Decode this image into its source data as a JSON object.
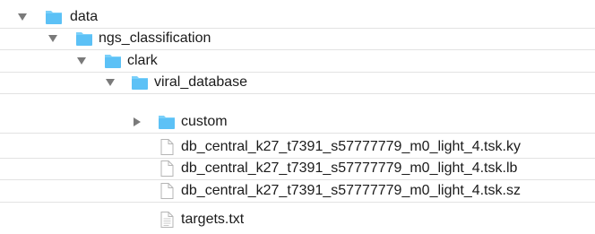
{
  "colors": {
    "folder_body": "#5cc1f6",
    "folder_tab": "#7ad0fa",
    "disclosure": "#7a7a7a",
    "text": "#1b1b1b"
  },
  "tree": [
    {
      "name": "data",
      "kind": "folder",
      "expanded": true,
      "icon": "folder-icon"
    },
    {
      "name": "ngs_classification",
      "kind": "folder",
      "expanded": true,
      "icon": "folder-icon"
    },
    {
      "name": "clark",
      "kind": "folder",
      "expanded": true,
      "icon": "folder-icon"
    },
    {
      "name": "viral_database",
      "kind": "folder",
      "expanded": true,
      "icon": "folder-icon"
    },
    {
      "name": "custom",
      "kind": "folder",
      "expanded": false,
      "icon": "folder-icon"
    },
    {
      "name": "db_central_k27_t7391_s57777779_m0_light_4.tsk.ky",
      "kind": "file",
      "icon": "document-icon"
    },
    {
      "name": "db_central_k27_t7391_s57777779_m0_light_4.tsk.lb",
      "kind": "file",
      "icon": "document-icon"
    },
    {
      "name": "db_central_k27_t7391_s57777779_m0_light_4.tsk.sz",
      "kind": "file",
      "icon": "document-icon"
    },
    {
      "name": "targets.txt",
      "kind": "file",
      "icon": "text-file-icon"
    }
  ]
}
